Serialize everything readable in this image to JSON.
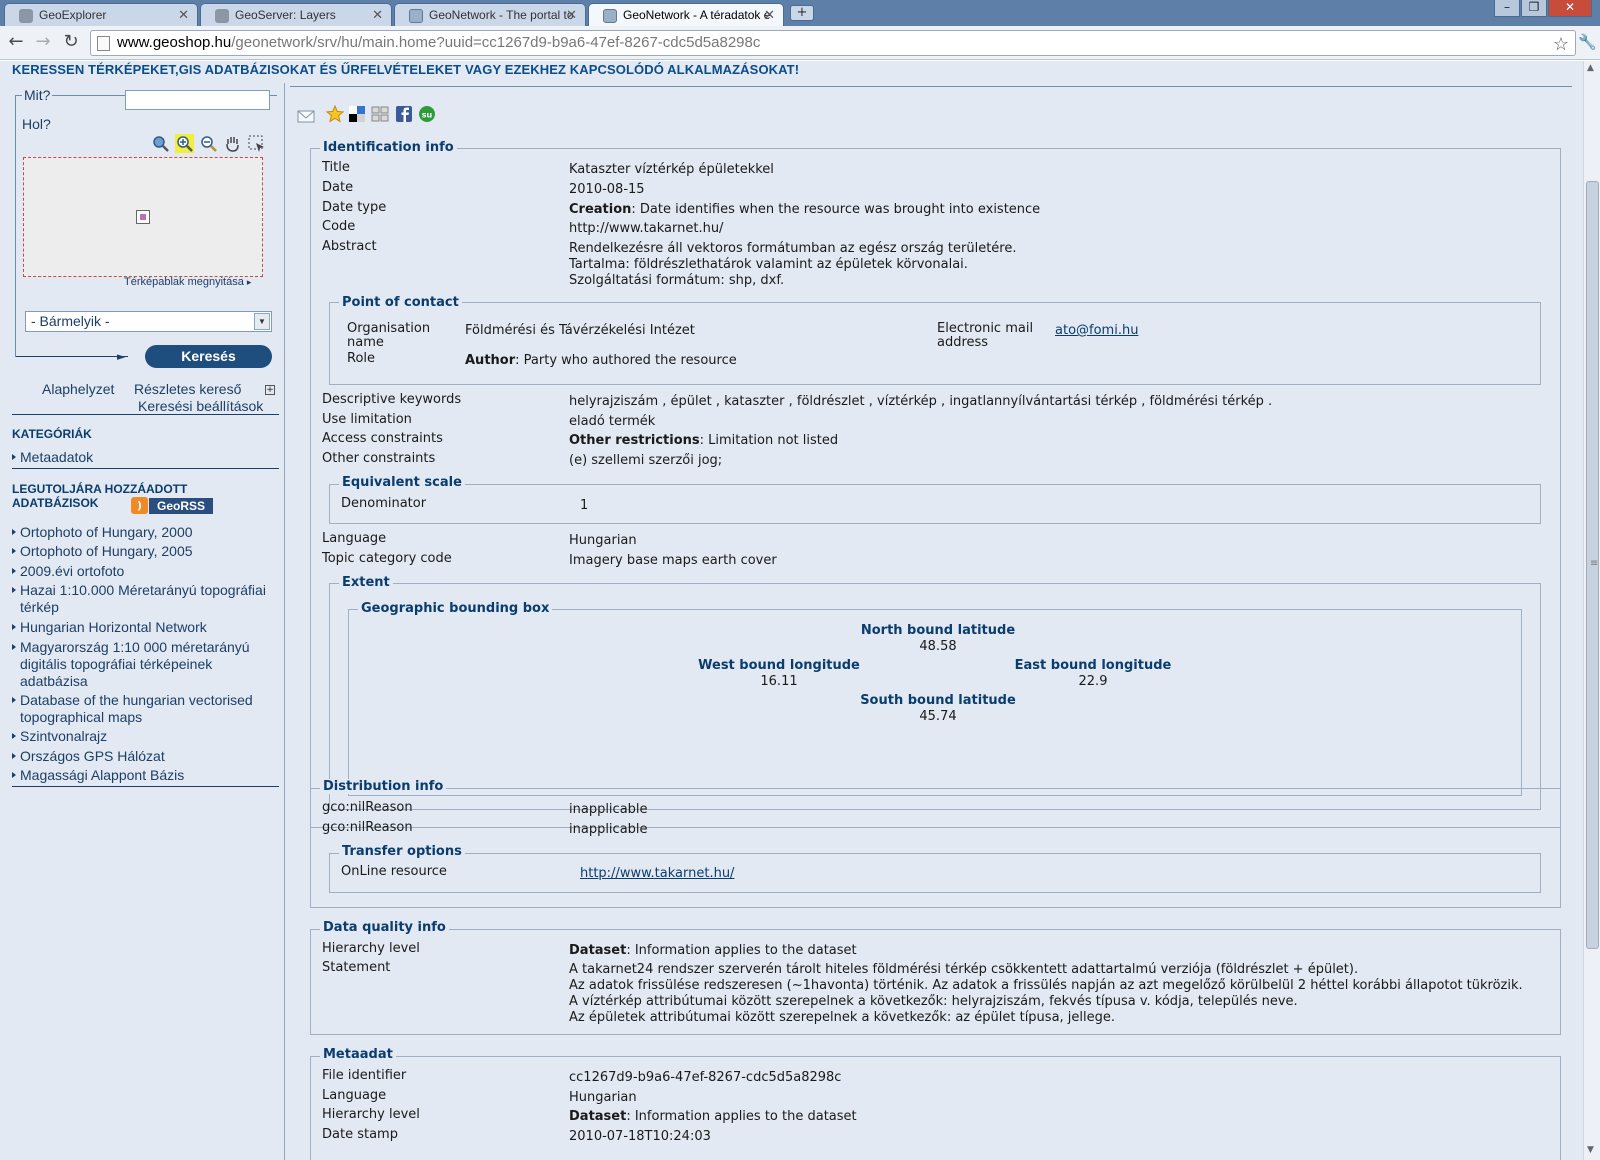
{
  "browser": {
    "tabs": [
      {
        "title": "GeoExplorer",
        "active": false
      },
      {
        "title": "GeoServer: Layers",
        "active": false
      },
      {
        "title": "GeoNetwork - The portal to",
        "active": false
      },
      {
        "title": "GeoNetwork - A téradatok e",
        "active": true
      }
    ],
    "new_tab": "+",
    "url_host": "www.geoshop.hu",
    "url_path": "/geonetwork/srv/hu/main.home?uuid=cc1267d9-b9a6-47ef-8267-cdc5d5a8298c"
  },
  "header": {
    "headline": "KERESSEN TÉRKÉPEKET,GIS ADATBÁZISOKAT ÉS ŰRFELVÉTELEKET VAGY EZEKHEZ KAPCSOLÓDÓ ALKALMAZÁSOKAT!"
  },
  "search": {
    "what_label": "Mit?",
    "where_label": "Hol?",
    "map_window_link": "Térképablak megnyitása",
    "region_select": "- Bármelyik -",
    "search_button": "Keresés",
    "reset_link": "Alaphelyzet",
    "advanced_link": "Részletes kereső",
    "settings_link": "Keresési beállítások"
  },
  "categories": {
    "title": "KATEGÓRIÁK",
    "items": [
      "Metaadatok"
    ]
  },
  "recent": {
    "title_line1": "LEGUTOLJÁRA HOZZÁADOTT",
    "title_line2": "ADATBÁZISOK",
    "georss": "GeoRSS",
    "items": [
      "Ortophoto of Hungary, 2000",
      "Ortophoto of Hungary, 2005",
      "2009.évi ortofoto",
      "Hazai 1:10.000 Méretarányú topográfiai térkép",
      "Hungarian Horizontal Network",
      "Magyarország 1:10 000 méretarányú digitális topográfiai térképeinek adatbázisa",
      "Database of the hungarian vectorised topographical maps",
      "Szintvonalrajz",
      "Országos GPS Hálózat",
      "Magassági Alappont Bázis"
    ]
  },
  "identification": {
    "legend": "Identification info",
    "title_key": "Title",
    "title_val": "Kataszter víztérkép épületekkel",
    "date_key": "Date",
    "date_val": "2010-08-15",
    "datetype_key": "Date type",
    "datetype_bold": "Creation",
    "datetype_val": ": Date identifies when the resource was brought into existence",
    "code_key": "Code",
    "code_val": "http://www.takarnet.hu/",
    "abstract_key": "Abstract",
    "abstract_lines": [
      "Rendelkezésre áll vektoros formátumban az egész ország területére.",
      "Tartalma: földrészlethatárok valamint az épületek körvonalai.",
      "Szolgáltatási formátum: shp, dxf."
    ],
    "contact": {
      "legend": "Point of contact",
      "org_key_1": "Organisation",
      "org_key_2": "name",
      "org_val": "Földmérési és Távérzékelési Intézet",
      "email_key_1": "Electronic mail",
      "email_key_2": "address",
      "email_val": "ato@fomi.hu",
      "role_key": "Role",
      "role_bold": "Author",
      "role_val": ": Party who authored the resource"
    },
    "keywords_key": "Descriptive keywords",
    "keywords_val": "helyrajziszám , épület , kataszter , földrészlet , víztérkép , ingatlannyílvántartási térkép , földmérési térkép .",
    "uselimit_key": "Use limitation",
    "uselimit_val": "eladó termék",
    "access_key": "Access constraints",
    "access_bold": "Other restrictions",
    "access_val": ": Limitation not listed",
    "other_key": "Other constraints",
    "other_val": "(e) szellemi szerzői jog;",
    "scale": {
      "legend": "Equivalent scale",
      "key": "Denominator",
      "val": "1"
    },
    "language_key": "Language",
    "language_val": "Hungarian",
    "topic_key": "Topic category code",
    "topic_val": "Imagery base maps earth cover",
    "extent": {
      "legend": "Extent",
      "bbox_legend": "Geographic bounding box",
      "north_label": "North bound latitude",
      "north_val": "48.58",
      "west_label": "West bound longitude",
      "west_val": "16.11",
      "east_label": "East bound longitude",
      "east_val": "22.9",
      "south_label": "South bound latitude",
      "south_val": "45.74"
    }
  },
  "distribution": {
    "legend": "Distribution info",
    "nil1_key": "gco:nilReason",
    "nil1_val": "inapplicable",
    "nil2_key": "gco:nilReason",
    "nil2_val": "inapplicable",
    "transfer": {
      "legend": "Transfer options",
      "key": "OnLine resource",
      "val": "http://www.takarnet.hu/"
    }
  },
  "quality": {
    "legend": "Data quality info",
    "hier_key": "Hierarchy level",
    "hier_bold": "Dataset",
    "hier_val": ": Information applies to the dataset",
    "stmt_key": "Statement",
    "stmt_lines": [
      "A takarnet24 rendszer szerverén tárolt hiteles földmérési térkép csökkentett adattartalmú verziója (földrészlet + épület).",
      "Az adatok frissülése redszeresen (~1havonta) történik. Az adatok a frissülés napján az azt megelőző körülbelül 2 héttel korábbi állapotot tükrözik.",
      "A víztérkép attribútumai között szerepelnek a következők: helyrajziszám, fekvés típusa v. kódja, település neve.",
      "Az épületek attribútumai között szerepelnek a következők: az épület típusa, jellege."
    ]
  },
  "metadata": {
    "legend": "Metaadat",
    "fileid_key": "File identifier",
    "fileid_val": "cc1267d9-b9a6-47ef-8267-cdc5d5a8298c",
    "lang_key": "Language",
    "lang_val": "Hungarian",
    "hier_key": "Hierarchy level",
    "hier_bold": "Dataset",
    "hier_val": ": Information applies to the dataset",
    "stamp_key": "Date stamp",
    "stamp_val": "2010-07-18T10:24:03"
  }
}
